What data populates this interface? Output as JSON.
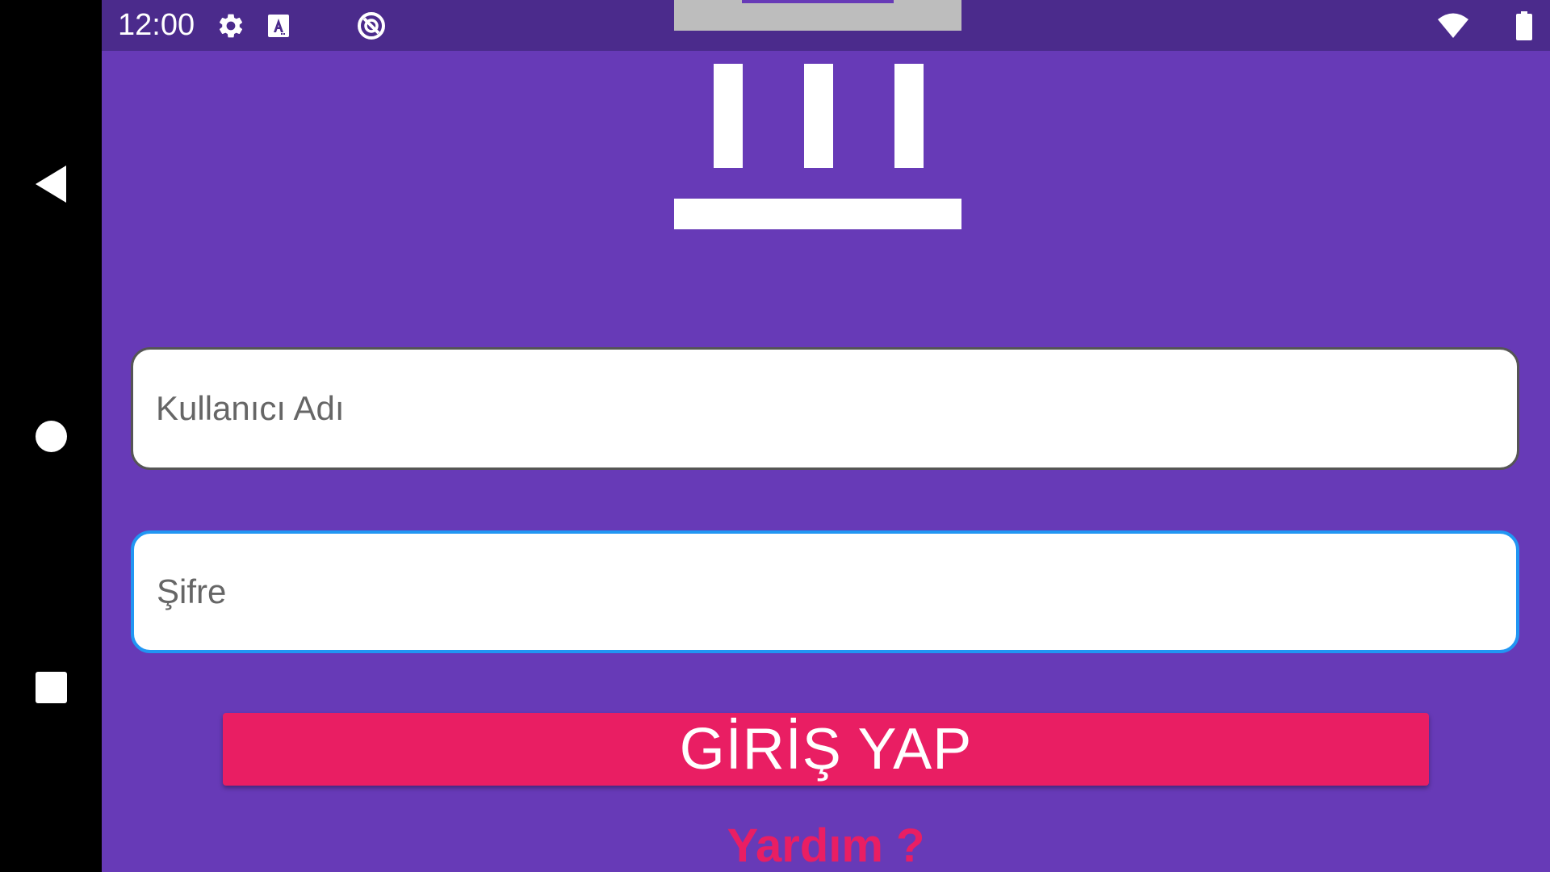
{
  "status_bar": {
    "time": "12:00",
    "icons": [
      "settings-gear-icon",
      "font-a-icon",
      "sync-circle-icon",
      "wifi-icon",
      "battery-icon"
    ]
  },
  "navigation": {
    "buttons": [
      "back",
      "home",
      "recents"
    ]
  },
  "logo": {
    "icon": "bank-building-icon"
  },
  "form": {
    "username_placeholder": "Kullanıcı Adı",
    "username_value": "",
    "password_placeholder": "Şifre",
    "password_value": ""
  },
  "login_button": {
    "label": "GİRİŞ YAP"
  },
  "help": {
    "label": "Yardım ?"
  },
  "colors": {
    "background": "#673ab7",
    "status_bar": "#4b2b8c",
    "accent": "#e91e63",
    "focus_border": "#2196f3",
    "logo_top": "#bdbdbd"
  }
}
